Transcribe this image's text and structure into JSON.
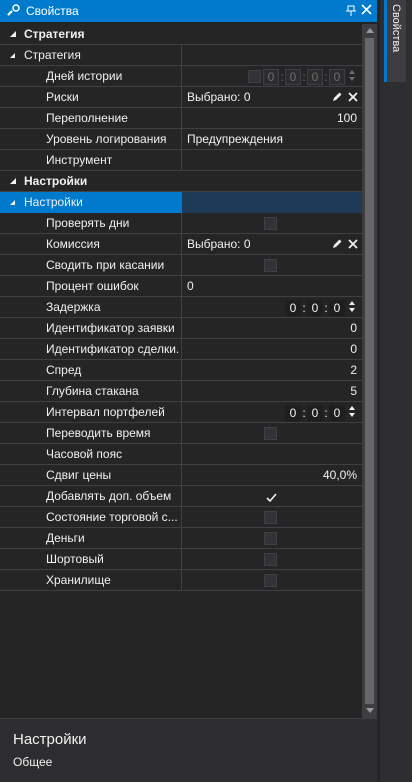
{
  "panel": {
    "title": "Свойства",
    "side_tab_label": "Свойства"
  },
  "grid": {
    "categories": [
      {
        "label": "Стратегия",
        "groups": [
          {
            "label": "Стратегия",
            "selected": false,
            "rows": [
              {
                "name": "Дней истории",
                "kind": "checkbox-time-disabled",
                "checked": false,
                "time": [
                  "0",
                  "0",
                  "0",
                  "0"
                ]
              },
              {
                "name": "Риски",
                "kind": "selection",
                "value": "Выбрано: 0"
              },
              {
                "name": "Переполнение",
                "kind": "number",
                "value": "100"
              },
              {
                "name": "Уровень логирования",
                "kind": "text",
                "value": "Предупреждения"
              },
              {
                "name": "Инструмент",
                "kind": "empty",
                "value": ""
              }
            ]
          }
        ]
      },
      {
        "label": "Настройки",
        "groups": [
          {
            "label": "Настройки",
            "selected": true,
            "rows": [
              {
                "name": "Проверять дни",
                "kind": "checkbox",
                "checked": false
              },
              {
                "name": "Комиссия",
                "kind": "selection",
                "value": "Выбрано: 0"
              },
              {
                "name": "Сводить при касании",
                "kind": "checkbox",
                "checked": false
              },
              {
                "name": "Процент ошибок",
                "kind": "text",
                "value": "0"
              },
              {
                "name": "Задержка",
                "kind": "time",
                "time": [
                  "0",
                  "0",
                  "0"
                ]
              },
              {
                "name": "Идентификатор заявки",
                "kind": "number",
                "value": "0"
              },
              {
                "name": "Идентификатор сделки.",
                "kind": "number",
                "value": "0"
              },
              {
                "name": "Спред",
                "kind": "number",
                "value": "2"
              },
              {
                "name": "Глубина стакана",
                "kind": "number",
                "value": "5"
              },
              {
                "name": "Интервал портфелей",
                "kind": "time",
                "time": [
                  "0",
                  "0",
                  "0"
                ]
              },
              {
                "name": "Переводить время",
                "kind": "checkbox",
                "checked": false
              },
              {
                "name": "Часовой пояс",
                "kind": "empty",
                "value": ""
              },
              {
                "name": "Сдвиг цены",
                "kind": "number",
                "value": "40,0%"
              },
              {
                "name": "Добавлять доп. объем",
                "kind": "checkbox",
                "checked": true
              },
              {
                "name": "Состояние торговой с...",
                "kind": "checkbox",
                "checked": false
              },
              {
                "name": "Деньги",
                "kind": "checkbox",
                "checked": false
              },
              {
                "name": "Шортовый",
                "kind": "checkbox",
                "checked": false
              },
              {
                "name": "Хранилище",
                "kind": "checkbox",
                "checked": false
              }
            ]
          }
        ]
      }
    ]
  },
  "description": {
    "title": "Настройки",
    "text": "Общее"
  },
  "colors": {
    "accent": "#007acc",
    "background": "#252526",
    "grid_line": "#3f3f46",
    "text": "#f1f1f1"
  }
}
